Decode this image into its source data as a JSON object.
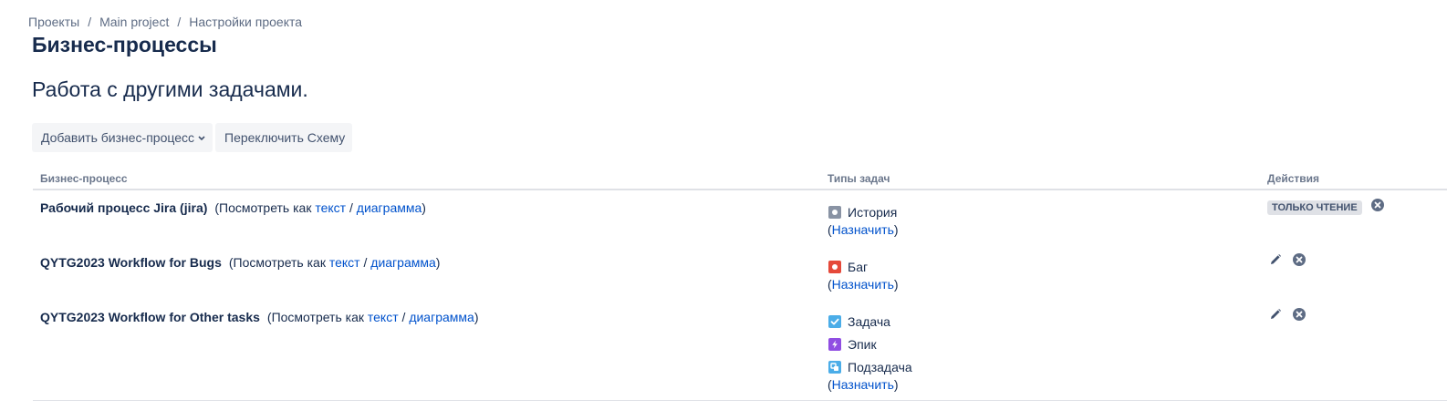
{
  "breadcrumb": {
    "items": [
      "Проекты",
      "Main project",
      "Настройки проекта"
    ],
    "separator": "/"
  },
  "page": {
    "title": "Бизнес-процессы",
    "subtitle": "Работа с другими задачами."
  },
  "toolbar": {
    "add_label": "Добавить бизнес-процесс",
    "switch_label": "Переключить Схему"
  },
  "table": {
    "headers": {
      "workflow": "Бизнес-процесс",
      "issue_types": "Типы задач",
      "actions": "Действия"
    },
    "view_prefix": "(Посмотреть как ",
    "view_text": "текст",
    "view_sep": " / ",
    "view_diagram": "диаграмма",
    "view_suffix": ")",
    "assign_open": "(",
    "assign_label": "Назначить",
    "assign_close": ")",
    "rows": [
      {
        "name": "Рабочий процесс Jira (jira)",
        "types": [
          {
            "label": "История",
            "icon": "story-icon"
          }
        ],
        "badge": "ТОЛЬКО ЧТЕНИЕ"
      },
      {
        "name": "QYTG2023 Workflow for Bugs",
        "types": [
          {
            "label": "Баг",
            "icon": "bug-icon"
          }
        ]
      },
      {
        "name": "QYTG2023 Workflow for Other tasks",
        "types": [
          {
            "label": "Задача",
            "icon": "task-icon"
          },
          {
            "label": "Эпик",
            "icon": "epic-icon"
          },
          {
            "label": "Подзадача",
            "icon": "subtask-icon"
          }
        ]
      }
    ]
  },
  "colors": {
    "link": "#0052cc",
    "text": "#172b4d",
    "bug": "#e5493a",
    "task": "#4bade8",
    "epic": "#904ee2",
    "story": "#8993a4",
    "badge_bg": "#dfe1e6"
  }
}
